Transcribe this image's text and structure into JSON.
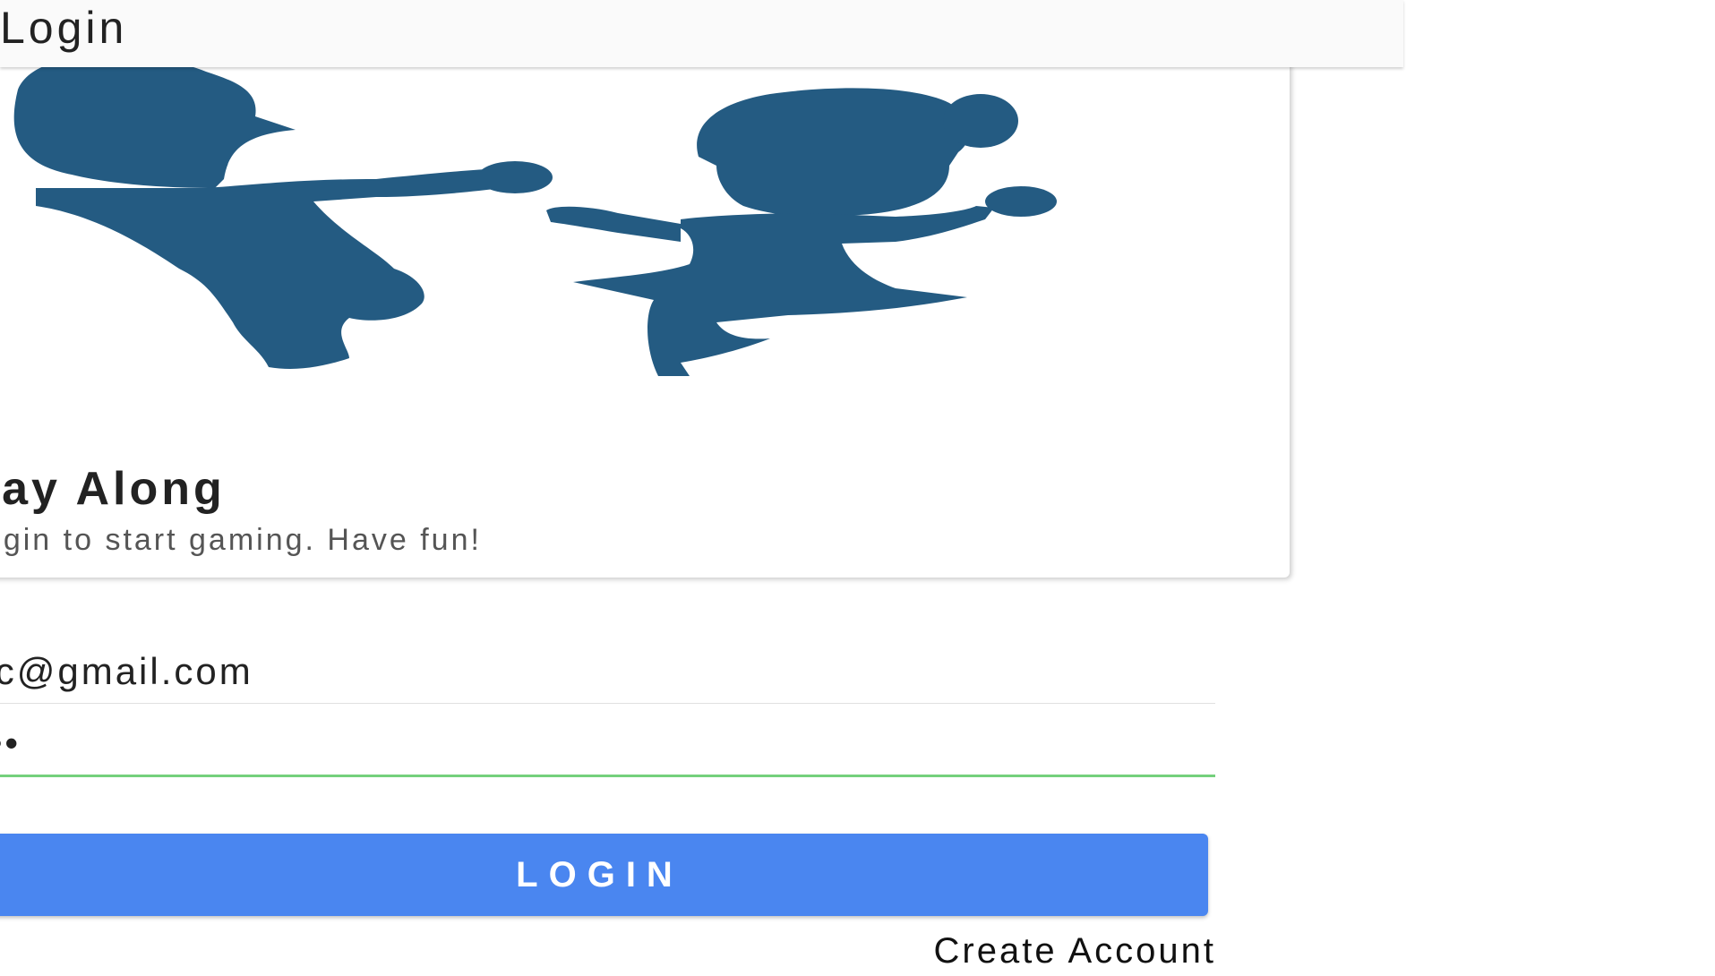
{
  "toolbar": {
    "title": "Login"
  },
  "card": {
    "title": "Play Along",
    "subtitle": "Login to start gaming. Have fun!",
    "illustration": "two-children-holding-hands-silhouette",
    "illustration_color": "#245b82"
  },
  "form": {
    "email_value": "doc@gmail.com",
    "password_value": "•••",
    "password_focus_color": "#74d07c",
    "login_label": "LOGIN",
    "login_color": "#4a86f0",
    "create_account_label": "Create Account"
  }
}
